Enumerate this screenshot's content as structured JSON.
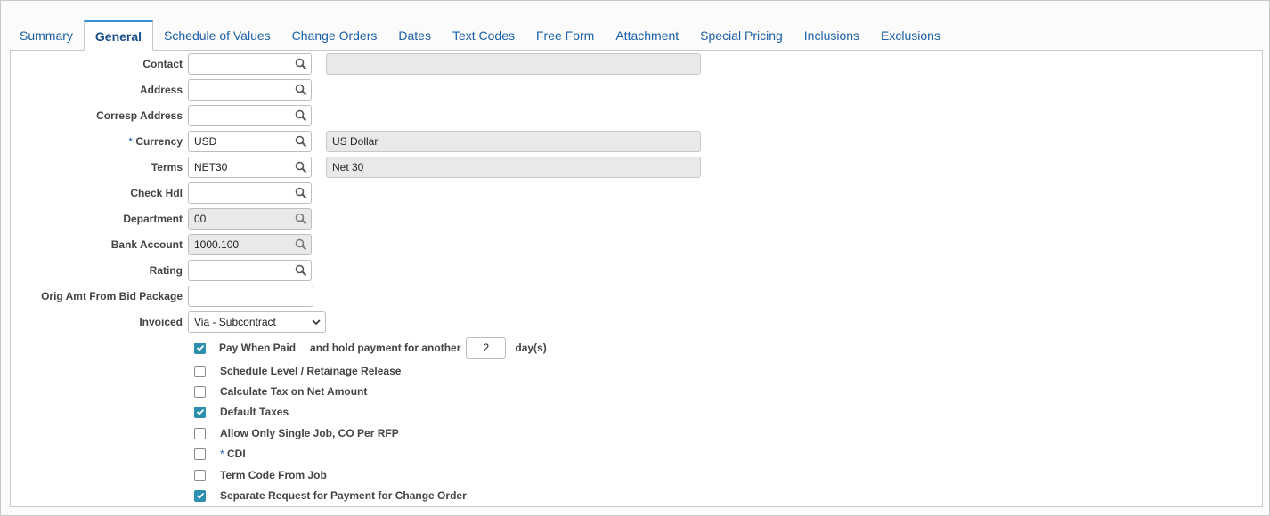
{
  "tabs": [
    {
      "label": "Summary",
      "active": false
    },
    {
      "label": "General",
      "active": true
    },
    {
      "label": "Schedule of Values",
      "active": false
    },
    {
      "label": "Change Orders",
      "active": false
    },
    {
      "label": "Dates",
      "active": false
    },
    {
      "label": "Text Codes",
      "active": false
    },
    {
      "label": "Free Form",
      "active": false
    },
    {
      "label": "Attachment",
      "active": false
    },
    {
      "label": "Special Pricing",
      "active": false
    },
    {
      "label": "Inclusions",
      "active": false
    },
    {
      "label": "Exclusions",
      "active": false
    }
  ],
  "form": {
    "contact": {
      "label": "Contact",
      "value": "",
      "description": ""
    },
    "address": {
      "label": "Address",
      "value": ""
    },
    "corresp_address": {
      "label": "Corresp Address",
      "value": ""
    },
    "currency": {
      "required_mark": "*",
      "label": "Currency",
      "value": "USD",
      "description": "US Dollar"
    },
    "terms": {
      "label": "Terms",
      "value": "NET30",
      "description": "Net 30"
    },
    "check_hdl": {
      "label": "Check Hdl",
      "value": ""
    },
    "department": {
      "label": "Department",
      "value": "00"
    },
    "bank_account": {
      "label": "Bank Account",
      "value": "1000.100"
    },
    "rating": {
      "label": "Rating",
      "value": ""
    },
    "orig_amt": {
      "label": "Orig Amt From Bid Package",
      "value": ""
    },
    "invoiced": {
      "label": "Invoiced",
      "value": "Via - Subcontract"
    }
  },
  "options": {
    "pay_when_paid": {
      "label": "Pay When Paid",
      "checked": true,
      "hold_label": "and hold payment for another",
      "days": "2",
      "days_label": "day(s)"
    },
    "schedule_level": {
      "label": "Schedule Level / Retainage Release",
      "checked": false
    },
    "calc_tax": {
      "label": "Calculate Tax on Net Amount",
      "checked": false
    },
    "default_taxes": {
      "label": "Default Taxes",
      "checked": true
    },
    "single_job": {
      "label": "Allow Only Single Job, CO Per RFP",
      "checked": false
    },
    "cdi": {
      "required_mark": "*",
      "label": "CDI",
      "checked": false
    },
    "term_code": {
      "label": "Term Code From Job",
      "checked": false
    },
    "separate_request": {
      "label": "Separate Request for Payment for Change Order",
      "checked": true
    }
  },
  "colors": {
    "accent": "#3a8fd9",
    "link": "#1b5fa7",
    "checkbox_on": "#2b8fb0"
  },
  "icons": {
    "lookup": "search-icon",
    "dropdown": "chevron-down-icon",
    "check": "checkmark-icon"
  }
}
